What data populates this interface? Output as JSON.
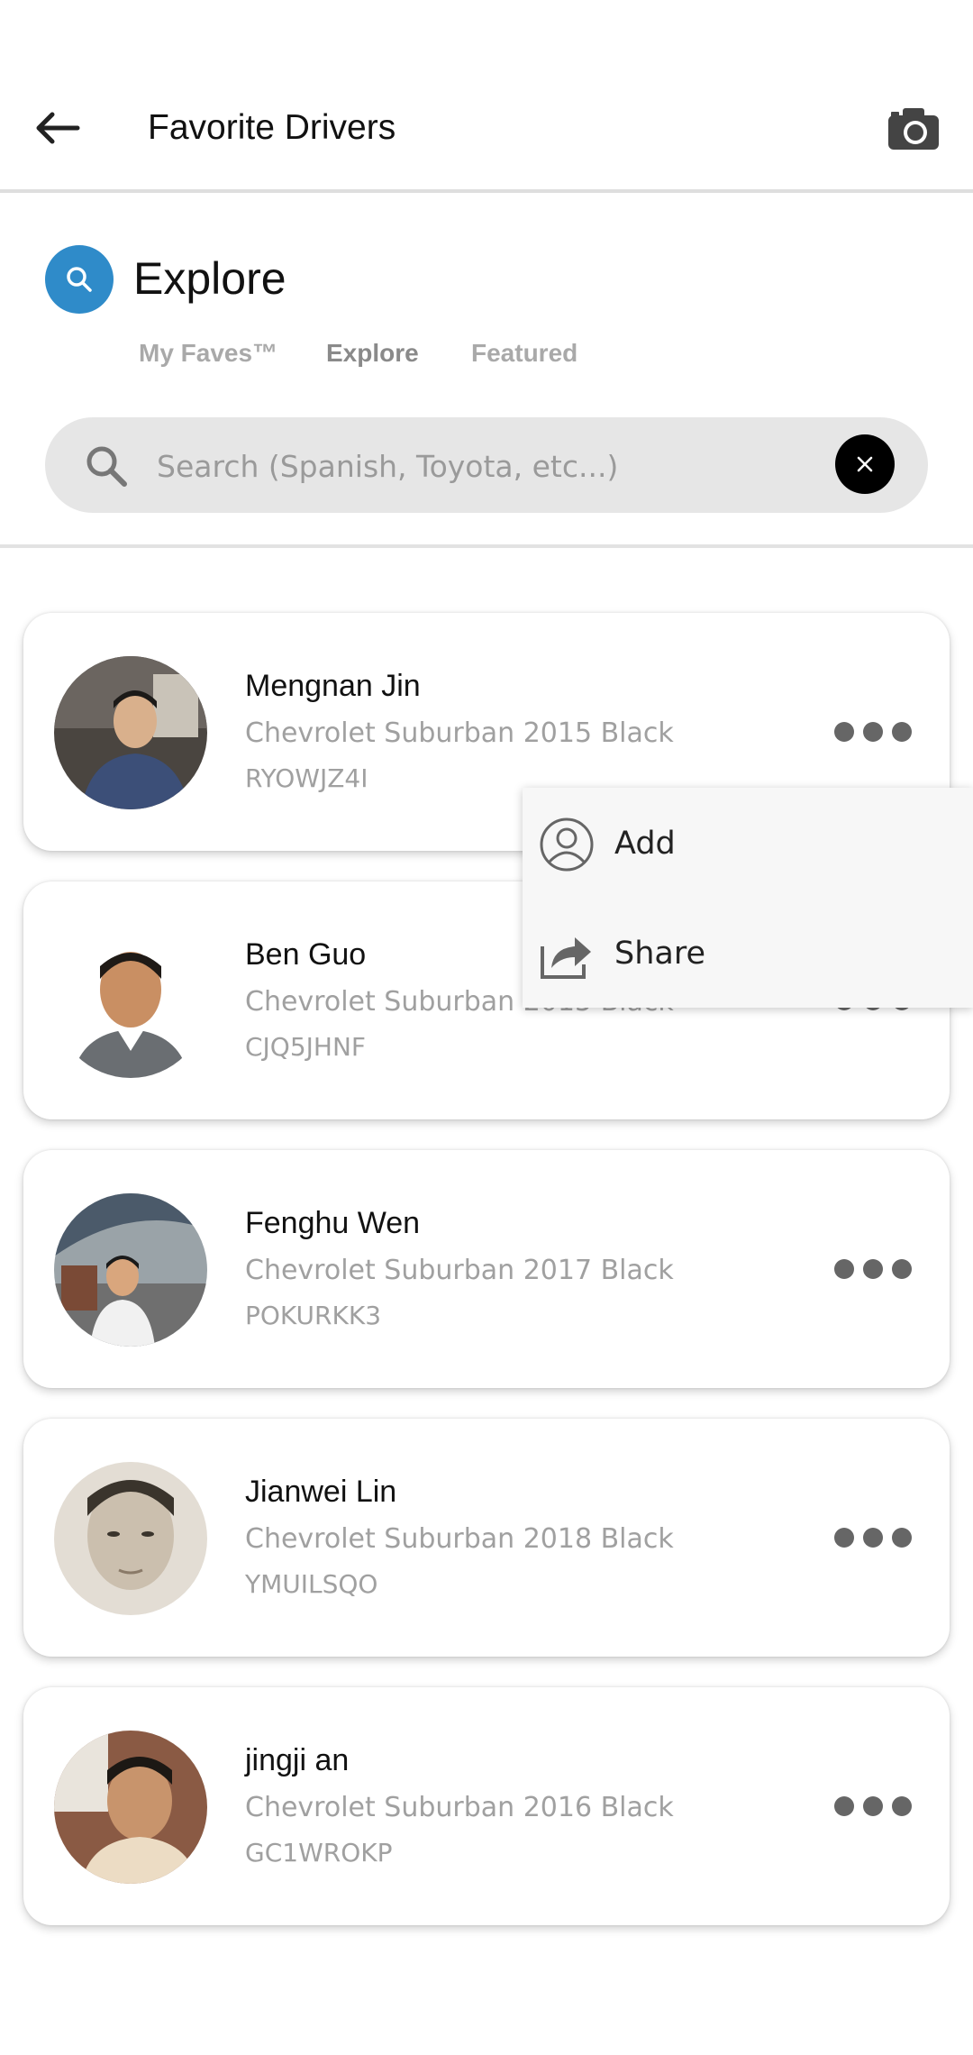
{
  "header": {
    "title": "Favorite Drivers",
    "back_icon": "arrow-left-icon",
    "camera_icon": "camera-icon"
  },
  "explore": {
    "title": "Explore",
    "icon": "search-icon",
    "accent": "#2f8bc9",
    "tabs": [
      {
        "label": "My Faves™"
      },
      {
        "label": "Explore",
        "active": true
      },
      {
        "label": "Featured"
      }
    ]
  },
  "search": {
    "placeholder": "Search (Spanish, Toyota, etc...)",
    "value": ""
  },
  "drivers": [
    {
      "name": "Mengnan Jin",
      "vehicle": "Chevrolet Suburban 2015 Black",
      "code": "RYOWJZ4I"
    },
    {
      "name": "Ben Guo",
      "vehicle": "Chevrolet Suburban 2015 Black",
      "code": "CJQ5JHNF"
    },
    {
      "name": "Fenghu Wen",
      "vehicle": "Chevrolet Suburban 2017 Black",
      "code": "POKURKK3"
    },
    {
      "name": "Jianwei Lin",
      "vehicle": "Chevrolet Suburban 2018 Black",
      "code": "YMUILSQO"
    },
    {
      "name": "jingji an",
      "vehicle": "Chevrolet Suburban 2016 Black",
      "code": "GC1WROKP"
    }
  ],
  "context_menu": {
    "items": [
      {
        "label": "Add",
        "icon": "user-circle-icon"
      },
      {
        "label": "Share",
        "icon": "share-icon"
      }
    ]
  }
}
